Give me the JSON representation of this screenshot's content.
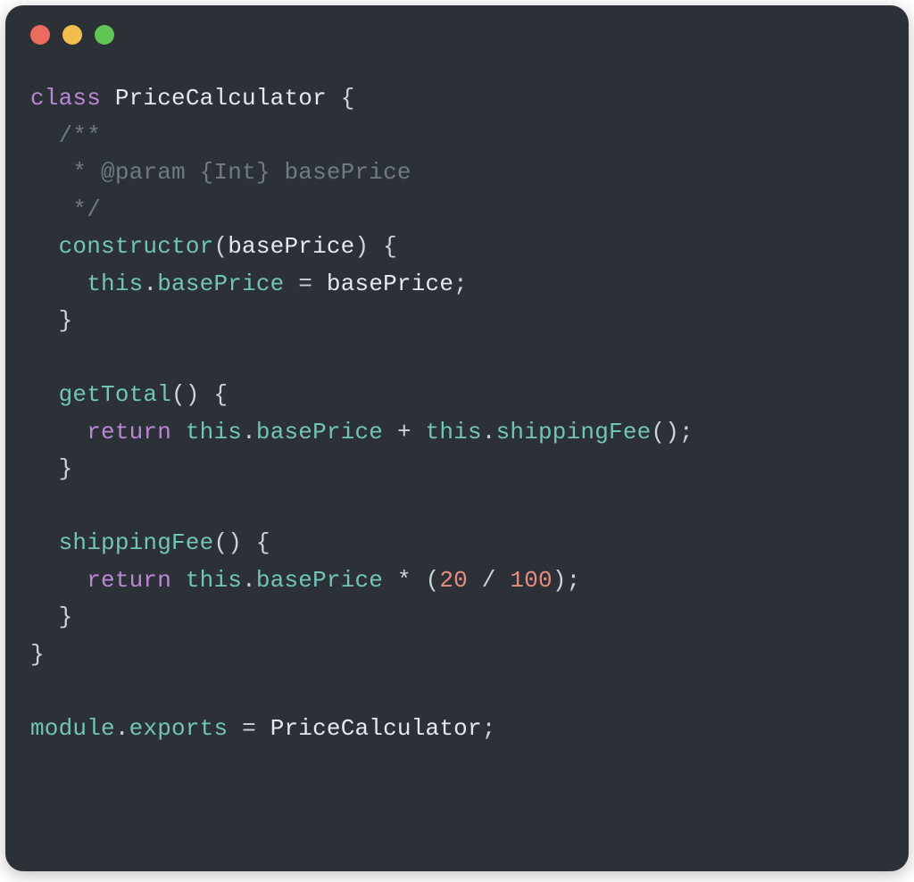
{
  "colors": {
    "close": "#ec6a5e",
    "minimize": "#f4be4f",
    "zoom": "#61c454",
    "background": "#2b3137"
  },
  "code": {
    "l1": {
      "kw": "class",
      "sp": " ",
      "cls": "PriceCalculator",
      "sp2": " ",
      "br": "{"
    },
    "l2": {
      "indent": "  ",
      "txt": "/**"
    },
    "l3": {
      "indent": "   ",
      "txt": "* @param {Int} basePrice"
    },
    "l4": {
      "indent": "   ",
      "txt": "*/"
    },
    "l5": {
      "indent": "  ",
      "method": "constructor",
      "paren1": "(",
      "param": "basePrice",
      "paren2": ")",
      "sp": " ",
      "br": "{"
    },
    "l6": {
      "indent": "    ",
      "thisk": "this",
      "dot": ".",
      "prop": "basePrice",
      "sp": " ",
      "eq": "=",
      "sp2": " ",
      "val": "basePrice",
      "semi": ";"
    },
    "l7": {
      "indent": "  ",
      "br": "}"
    },
    "l8": {
      "blank": ""
    },
    "l9": {
      "indent": "  ",
      "method": "getTotal",
      "parens": "()",
      "sp": " ",
      "br": "{"
    },
    "l10": {
      "indent": "    ",
      "kw": "return",
      "sp": " ",
      "thisk": "this",
      "dot": ".",
      "prop": "basePrice",
      "sp2": " ",
      "op": "+",
      "sp3": " ",
      "thisk2": "this",
      "dot2": ".",
      "call": "shippingFee",
      "parens": "()",
      "semi": ";"
    },
    "l11": {
      "indent": "  ",
      "br": "}"
    },
    "l12": {
      "blank": ""
    },
    "l13": {
      "indent": "  ",
      "method": "shippingFee",
      "parens": "()",
      "sp": " ",
      "br": "{"
    },
    "l14": {
      "indent": "    ",
      "kw": "return",
      "sp": " ",
      "thisk": "this",
      "dot": ".",
      "prop": "basePrice",
      "sp2": " ",
      "op": "*",
      "sp3": " ",
      "p1": "(",
      "n1": "20",
      "sp4": " ",
      "div": "/",
      "sp5": " ",
      "n2": "100",
      "p2": ")",
      "semi": ";"
    },
    "l15": {
      "indent": "  ",
      "br": "}"
    },
    "l16": {
      "br": "}"
    },
    "l17": {
      "blank": ""
    },
    "l18": {
      "mod": "module",
      "dot": ".",
      "exp": "exports",
      "sp": " ",
      "eq": "=",
      "sp2": " ",
      "cls": "PriceCalculator",
      "semi": ";"
    }
  }
}
